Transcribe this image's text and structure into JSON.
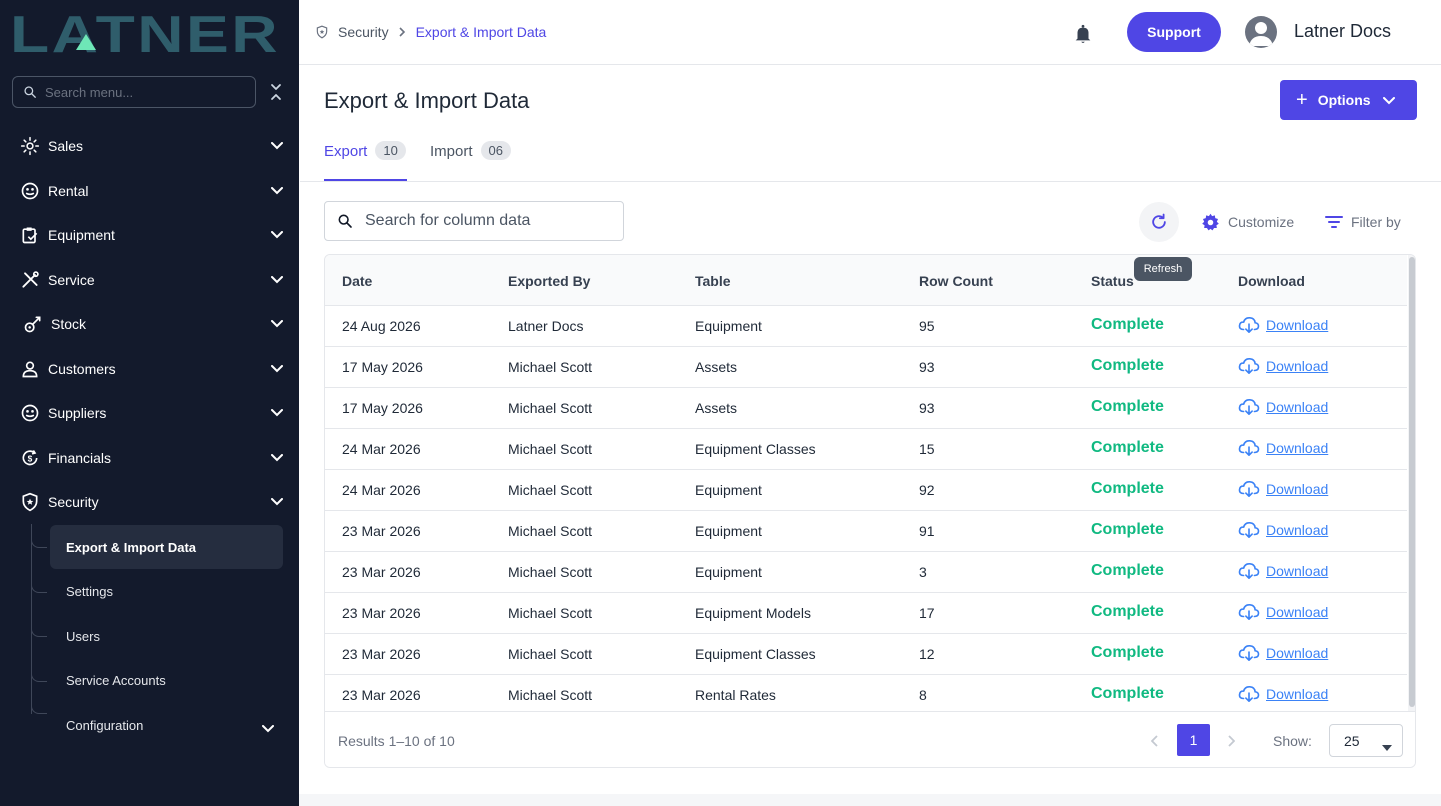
{
  "brand": {
    "logo_text": "LATNER",
    "accent": "#4f46e5"
  },
  "sidebar": {
    "search_placeholder": "Search menu...",
    "items": [
      {
        "label": "Sales",
        "icon": "sales-icon"
      },
      {
        "label": "Rental",
        "icon": "rental-icon"
      },
      {
        "label": "Equipment",
        "icon": "equipment-icon"
      },
      {
        "label": "Service",
        "icon": "service-icon"
      },
      {
        "label": "Stock",
        "icon": "stock-icon"
      },
      {
        "label": "Customers",
        "icon": "customers-icon"
      },
      {
        "label": "Suppliers",
        "icon": "suppliers-icon"
      },
      {
        "label": "Financials",
        "icon": "financials-icon"
      },
      {
        "label": "Security",
        "icon": "shield-icon"
      }
    ],
    "security_children": [
      {
        "label": "Export & Import Data",
        "active": true
      },
      {
        "label": "Settings"
      },
      {
        "label": "Users"
      },
      {
        "label": "Service Accounts"
      },
      {
        "label": "Configuration"
      }
    ]
  },
  "header": {
    "breadcrumb": [
      "Security",
      "Export & Import Data"
    ],
    "support_label": "Support",
    "user_name": "Latner Docs"
  },
  "main": {
    "title": "Export & Import Data",
    "options_label": "Options",
    "tabs": [
      {
        "label": "Export",
        "count": "10",
        "active": true
      },
      {
        "label": "Import",
        "count": "06",
        "active": false
      }
    ],
    "search_placeholder": "Search for column data",
    "toolbar": {
      "refresh_tooltip": "Refresh",
      "customize_label": "Customize",
      "filter_label": "Filter by"
    }
  },
  "table": {
    "columns": [
      "Date",
      "Exported By",
      "Table",
      "Row Count",
      "Status",
      "Download"
    ],
    "rows": [
      {
        "date": "24 Aug 2026",
        "by": "Latner Docs",
        "table": "Equipment",
        "count": "95",
        "status": "Complete",
        "download": "Download"
      },
      {
        "date": "17 May 2026",
        "by": "Michael Scott",
        "table": "Assets",
        "count": "93",
        "status": "Complete",
        "download": "Download"
      },
      {
        "date": "17 May 2026",
        "by": "Michael Scott",
        "table": "Assets",
        "count": "93",
        "status": "Complete",
        "download": "Download"
      },
      {
        "date": "24 Mar 2026",
        "by": "Michael Scott",
        "table": "Equipment Classes",
        "count": "15",
        "status": "Complete",
        "download": "Download"
      },
      {
        "date": "24 Mar 2026",
        "by": "Michael Scott",
        "table": "Equipment",
        "count": "92",
        "status": "Complete",
        "download": "Download"
      },
      {
        "date": "23 Mar 2026",
        "by": "Michael Scott",
        "table": "Equipment",
        "count": "91",
        "status": "Complete",
        "download": "Download"
      },
      {
        "date": "23 Mar 2026",
        "by": "Michael Scott",
        "table": "Equipment",
        "count": "3",
        "status": "Complete",
        "download": "Download"
      },
      {
        "date": "23 Mar 2026",
        "by": "Michael Scott",
        "table": "Equipment Models",
        "count": "17",
        "status": "Complete",
        "download": "Download"
      },
      {
        "date": "23 Mar 2026",
        "by": "Michael Scott",
        "table": "Equipment Classes",
        "count": "12",
        "status": "Complete",
        "download": "Download"
      },
      {
        "date": "23 Mar 2026",
        "by": "Michael Scott",
        "table": "Rental Rates",
        "count": "8",
        "status": "Complete",
        "download": "Download"
      }
    ],
    "footer": {
      "results": "Results 1–10 of 10",
      "current_page": "1",
      "show_label": "Show:",
      "page_size": "25"
    }
  }
}
